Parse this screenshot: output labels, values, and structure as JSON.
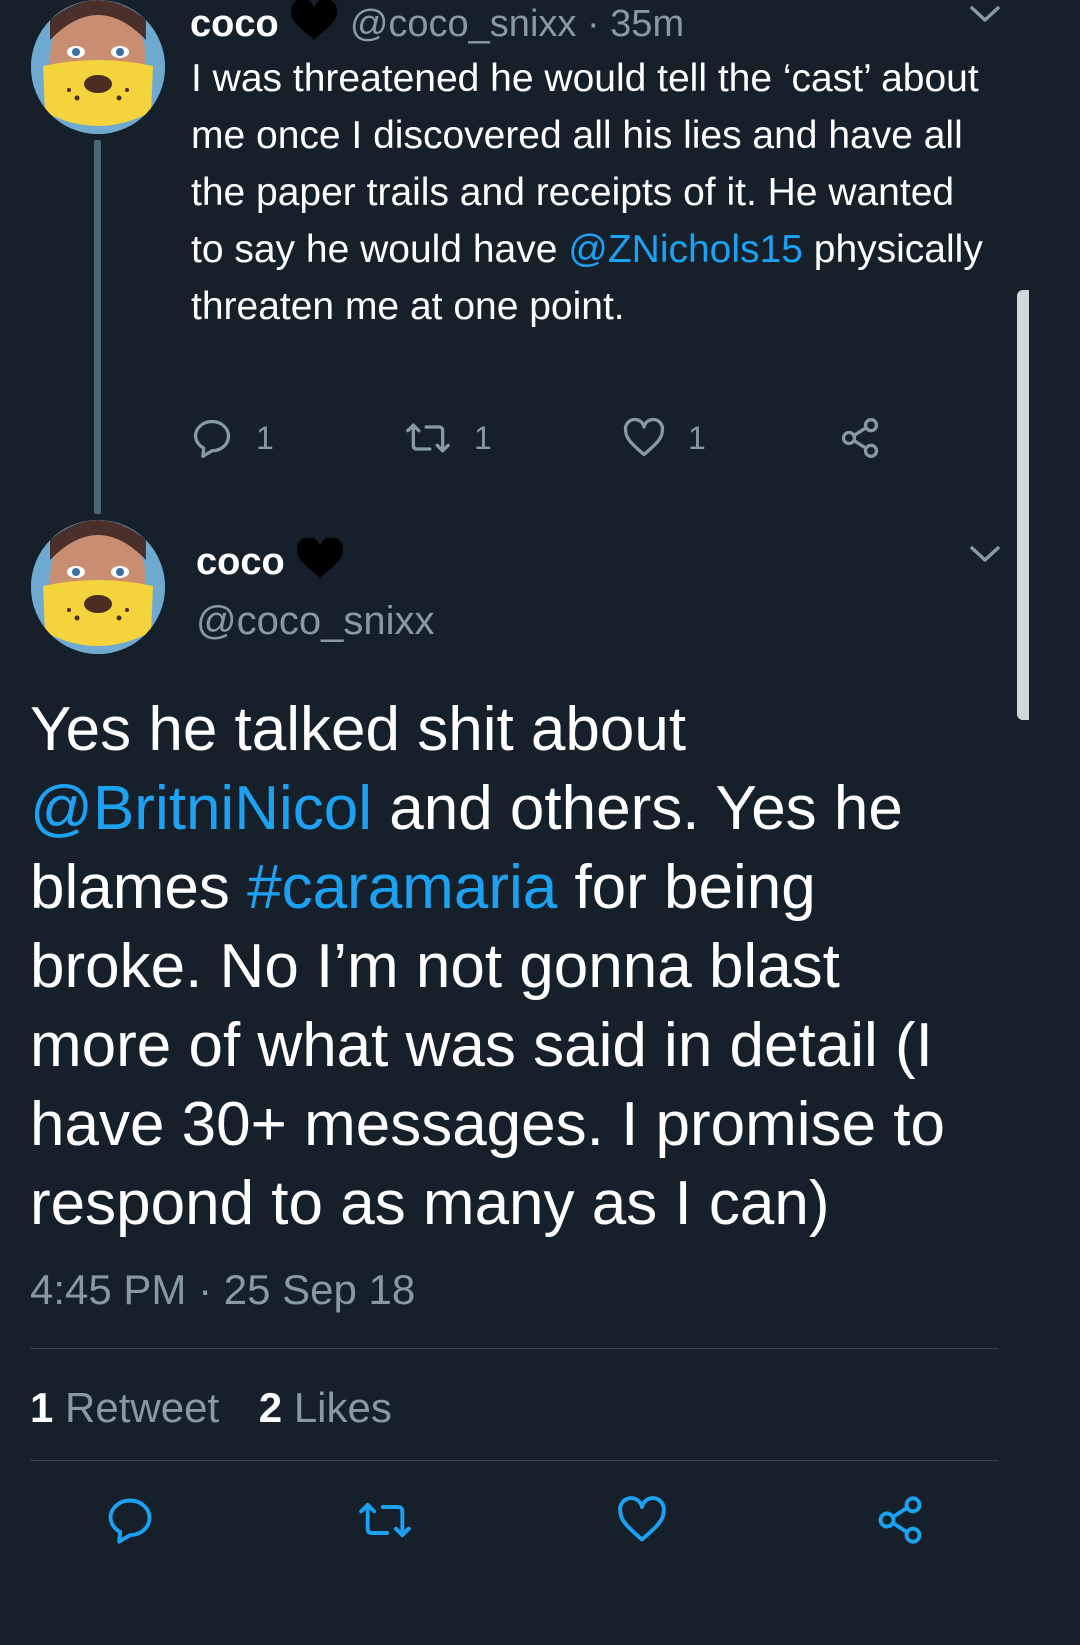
{
  "colors": {
    "background": "#15202b",
    "text": "#ffffff",
    "muted": "#8899a6",
    "link": "#1da1f2",
    "divider": "#38444d"
  },
  "tweet1": {
    "name": "coco",
    "handle": "@coco_snixx",
    "separator": "·",
    "age": "35m",
    "text": {
      "part1": "I was threatened he would tell the ‘cast’ about me once I discovered all his lies and have all the paper trails and receipts of it. He wanted to say he would have ",
      "mention": "@ZNichols15",
      "part2": " physically threaten me at one point."
    },
    "actions": {
      "replies": "1",
      "retweets": "1",
      "likes": "1"
    }
  },
  "tweet2": {
    "name": "coco",
    "handle": "@coco_snixx",
    "text": {
      "part1": "Yes he talked shit about ",
      "mention": "@BritniNicol",
      "part2": " and others. Yes he blames ",
      "hashtag": "#caramaria",
      "part3": " for being broke. No I’m not gonna blast more of what was said in detail (I have 30+ messages. I promise to respond to as many as I can)"
    },
    "timestamp": "4:45 PM · 25 Sep 18",
    "stats": {
      "retweet_count": "1",
      "retweet_label": "Retweet",
      "like_count": "2",
      "like_label": "Likes"
    }
  },
  "icons": [
    "avatar",
    "heart-badge-icon",
    "chevron-down-icon",
    "reply-icon",
    "retweet-icon",
    "like-icon",
    "share-icon"
  ]
}
